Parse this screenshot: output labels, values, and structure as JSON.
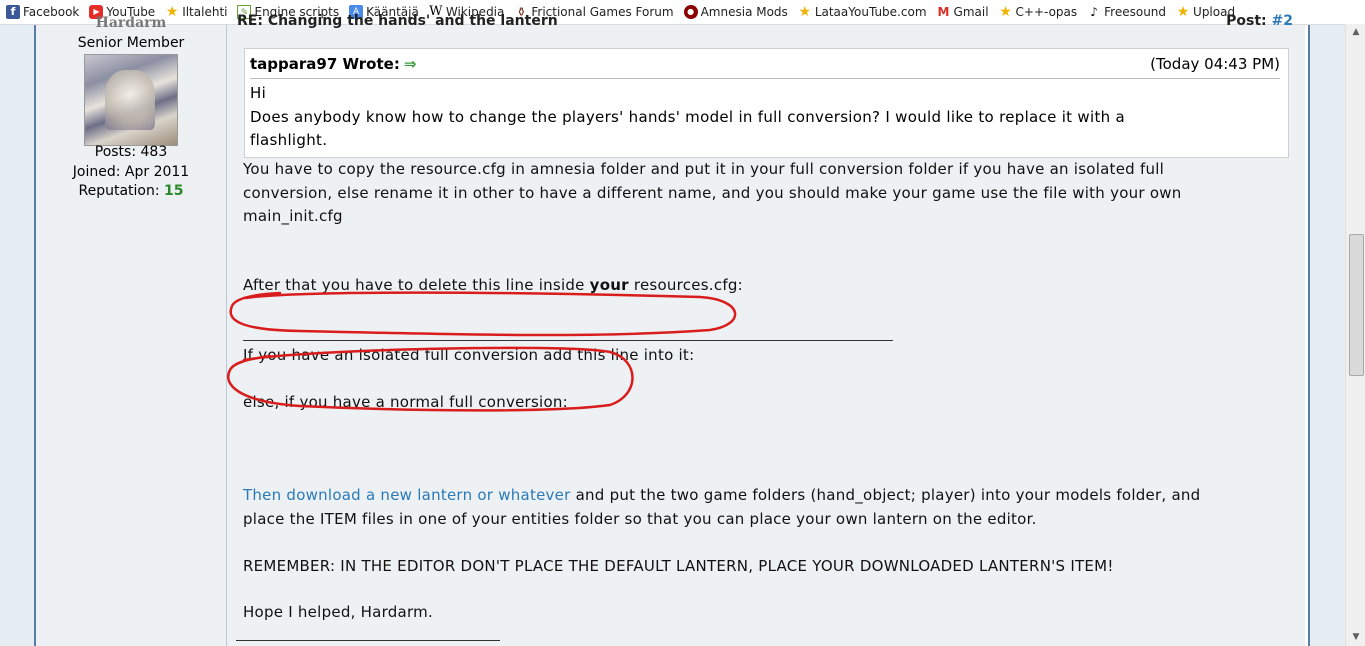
{
  "bookmarks": [
    {
      "label": "Facebook",
      "icon": "facebook-icon",
      "glyph": "f"
    },
    {
      "label": "YouTube",
      "icon": "youtube-icon",
      "glyph": "▶"
    },
    {
      "label": "Iltalehti",
      "icon": "star-icon",
      "glyph": "★"
    },
    {
      "label": "Engine scripts",
      "icon": "engine-scripts-icon",
      "glyph": "✎"
    },
    {
      "label": "Kääntäjä",
      "icon": "translate-icon",
      "glyph": "A"
    },
    {
      "label": "Wikipedia",
      "icon": "wikipedia-icon",
      "glyph": "W"
    },
    {
      "label": "Frictional Games Forum",
      "icon": "frictional-games-icon",
      "glyph": "⚱"
    },
    {
      "label": "Amnesia Mods",
      "icon": "amnesia-icon",
      "glyph": "●"
    },
    {
      "label": "LataaYouTube.com",
      "icon": "star-icon",
      "glyph": "★"
    },
    {
      "label": "Gmail",
      "icon": "gmail-icon",
      "glyph": "M"
    },
    {
      "label": "C++-opas",
      "icon": "star-icon",
      "glyph": "★"
    },
    {
      "label": "Freesound",
      "icon": "freesound-icon",
      "glyph": "♪"
    },
    {
      "label": "Upload",
      "icon": "star-icon",
      "glyph": "★"
    }
  ],
  "author": {
    "name": "Hardarm",
    "rank": "Senior Member",
    "posts": "Posts: 483",
    "joined": "Joined: Apr 2011",
    "reputation_label": "Reputation:",
    "reputation_value": "15"
  },
  "post": {
    "title": "RE: Changing the hands' and the lantern",
    "post_label": "Post:",
    "post_number": "#2",
    "quote": {
      "author": "tappara97 Wrote:",
      "arrow": "⇒",
      "time": "(Today 04:43 PM)",
      "line1": "Hi",
      "line2": "Does anybody know how to change the players' hands' model in full conversion? I would like to replace it with a",
      "line3": "flashlight."
    },
    "p1_line1": "You have to copy the resource.cfg in amnesia folder and put it in your full conversion folder if you have an isolated full",
    "p1_line2": "conversion, else rename it in other to have a different name, and you should make your game use the file with your own",
    "p1_line3": "main_init.cfg",
    "p2_prefix": "After that you have to delete this line inside ",
    "p2_bold": "your",
    "p2_suffix": " resources.cfg:",
    "p3": "If you have an isolated full conversion add this line into it:",
    "p4": "else, if you have a normal full conversion:",
    "link": "Then download a new lantern or whatever",
    "p5_suffix": " and put the two game folders (hand_object; player) into your models folder, and",
    "p5_line2": "place the ITEM files in one of your entities folder so that you can place your own lantern on the editor.",
    "p6": "REMEMBER: IN THE EDITOR DON'T PLACE THE DEFAULT LANTERN, PLACE YOUR DOWNLOADED LANTERN'S ITEM!",
    "p7": "Hope I helped, Hardarm."
  },
  "colors": {
    "link": "#2a7ab8",
    "reputation": "#2a8a2a",
    "annotation": "#d91c1c",
    "frame_border": "#5a7da8"
  }
}
